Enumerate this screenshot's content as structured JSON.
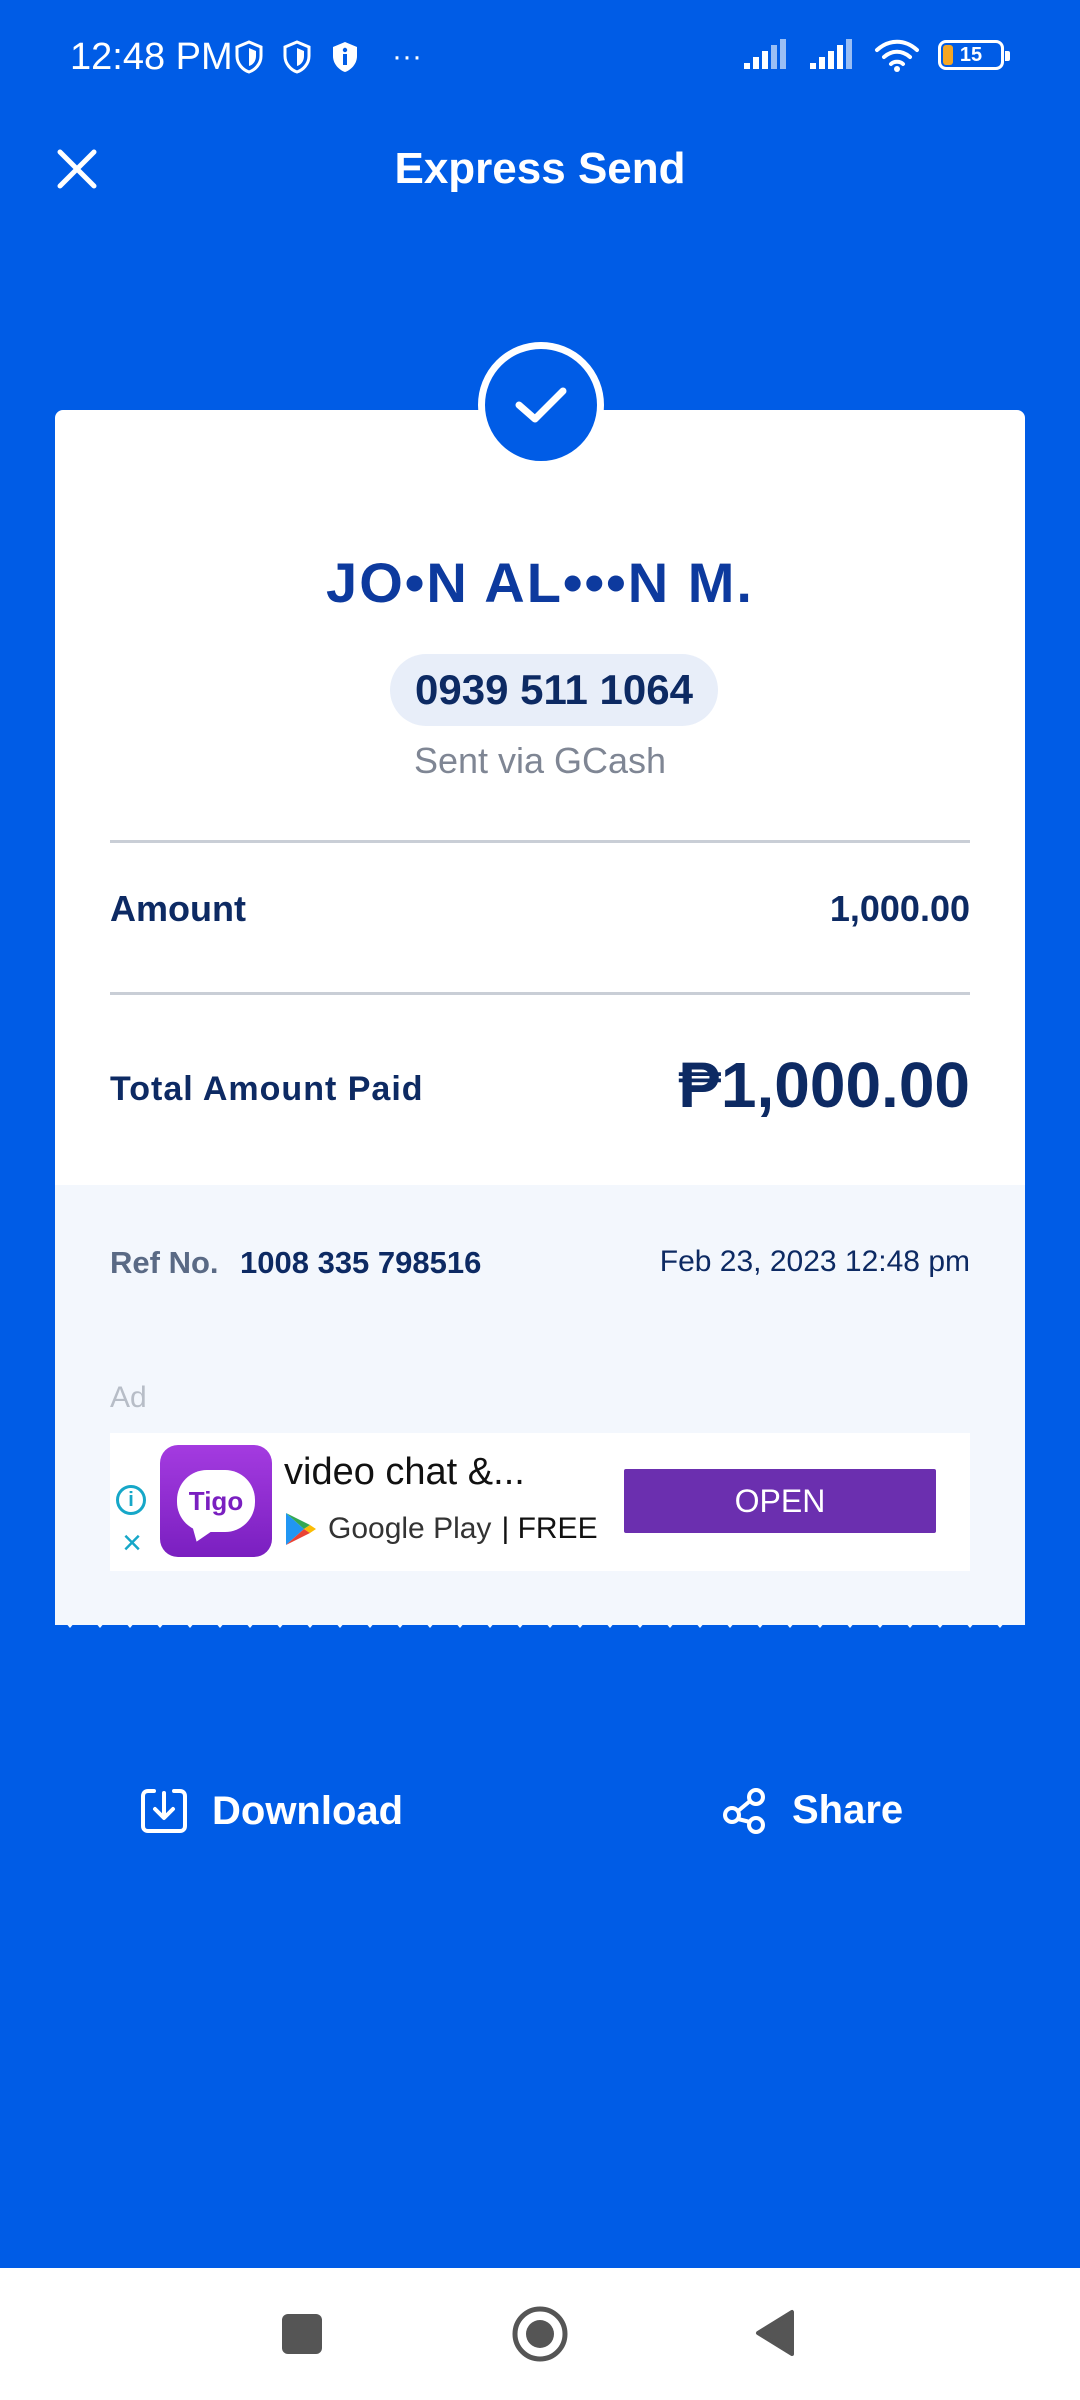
{
  "status_bar": {
    "time": "12:48 PM",
    "battery": "15",
    "more": "···"
  },
  "header": {
    "title": "Express Send"
  },
  "receipt": {
    "recipient_name": "JO•N AL•••N M.",
    "phone": "0939 511 1064",
    "sent_via": "Sent via GCash",
    "amount_label": "Amount",
    "amount_value": "1,000.00",
    "total_label": "Total Amount Paid",
    "total_value": "₱1,000.00",
    "ref_label": "Ref No.",
    "ref_number": "1008 335 798516",
    "date": "Feb 23, 2023 12:48 pm"
  },
  "ad": {
    "label": "Ad",
    "app_icon_text": "Tigo",
    "title": "video chat &...",
    "store": "Google Play",
    "price": "| FREE",
    "cta": "OPEN"
  },
  "actions": {
    "download_label": "Download",
    "share_label": "Share"
  },
  "colors": {
    "brand_blue": "#005CE6",
    "ad_button": "#6B2FAF"
  }
}
